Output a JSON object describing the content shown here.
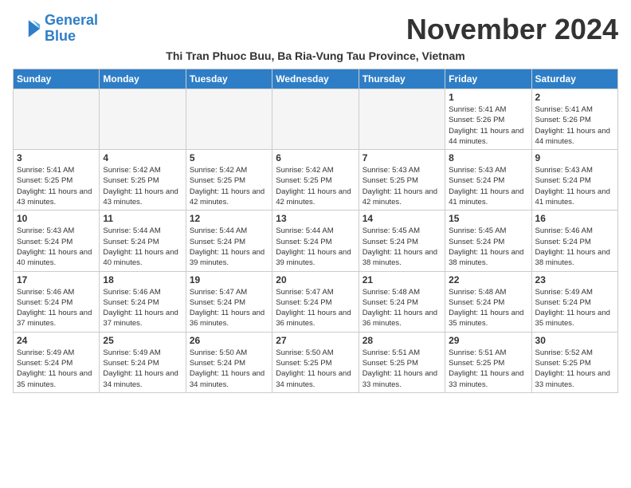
{
  "logo": {
    "line1": "General",
    "line2": "Blue"
  },
  "title": "November 2024",
  "subtitle": "Thi Tran Phuoc Buu, Ba Ria-Vung Tau Province, Vietnam",
  "days_of_week": [
    "Sunday",
    "Monday",
    "Tuesday",
    "Wednesday",
    "Thursday",
    "Friday",
    "Saturday"
  ],
  "weeks": [
    [
      {
        "day": "",
        "info": ""
      },
      {
        "day": "",
        "info": ""
      },
      {
        "day": "",
        "info": ""
      },
      {
        "day": "",
        "info": ""
      },
      {
        "day": "",
        "info": ""
      },
      {
        "day": "1",
        "info": "Sunrise: 5:41 AM\nSunset: 5:26 PM\nDaylight: 11 hours and 44 minutes."
      },
      {
        "day": "2",
        "info": "Sunrise: 5:41 AM\nSunset: 5:26 PM\nDaylight: 11 hours and 44 minutes."
      }
    ],
    [
      {
        "day": "3",
        "info": "Sunrise: 5:41 AM\nSunset: 5:25 PM\nDaylight: 11 hours and 43 minutes."
      },
      {
        "day": "4",
        "info": "Sunrise: 5:42 AM\nSunset: 5:25 PM\nDaylight: 11 hours and 43 minutes."
      },
      {
        "day": "5",
        "info": "Sunrise: 5:42 AM\nSunset: 5:25 PM\nDaylight: 11 hours and 42 minutes."
      },
      {
        "day": "6",
        "info": "Sunrise: 5:42 AM\nSunset: 5:25 PM\nDaylight: 11 hours and 42 minutes."
      },
      {
        "day": "7",
        "info": "Sunrise: 5:43 AM\nSunset: 5:25 PM\nDaylight: 11 hours and 42 minutes."
      },
      {
        "day": "8",
        "info": "Sunrise: 5:43 AM\nSunset: 5:24 PM\nDaylight: 11 hours and 41 minutes."
      },
      {
        "day": "9",
        "info": "Sunrise: 5:43 AM\nSunset: 5:24 PM\nDaylight: 11 hours and 41 minutes."
      }
    ],
    [
      {
        "day": "10",
        "info": "Sunrise: 5:43 AM\nSunset: 5:24 PM\nDaylight: 11 hours and 40 minutes."
      },
      {
        "day": "11",
        "info": "Sunrise: 5:44 AM\nSunset: 5:24 PM\nDaylight: 11 hours and 40 minutes."
      },
      {
        "day": "12",
        "info": "Sunrise: 5:44 AM\nSunset: 5:24 PM\nDaylight: 11 hours and 39 minutes."
      },
      {
        "day": "13",
        "info": "Sunrise: 5:44 AM\nSunset: 5:24 PM\nDaylight: 11 hours and 39 minutes."
      },
      {
        "day": "14",
        "info": "Sunrise: 5:45 AM\nSunset: 5:24 PM\nDaylight: 11 hours and 38 minutes."
      },
      {
        "day": "15",
        "info": "Sunrise: 5:45 AM\nSunset: 5:24 PM\nDaylight: 11 hours and 38 minutes."
      },
      {
        "day": "16",
        "info": "Sunrise: 5:46 AM\nSunset: 5:24 PM\nDaylight: 11 hours and 38 minutes."
      }
    ],
    [
      {
        "day": "17",
        "info": "Sunrise: 5:46 AM\nSunset: 5:24 PM\nDaylight: 11 hours and 37 minutes."
      },
      {
        "day": "18",
        "info": "Sunrise: 5:46 AM\nSunset: 5:24 PM\nDaylight: 11 hours and 37 minutes."
      },
      {
        "day": "19",
        "info": "Sunrise: 5:47 AM\nSunset: 5:24 PM\nDaylight: 11 hours and 36 minutes."
      },
      {
        "day": "20",
        "info": "Sunrise: 5:47 AM\nSunset: 5:24 PM\nDaylight: 11 hours and 36 minutes."
      },
      {
        "day": "21",
        "info": "Sunrise: 5:48 AM\nSunset: 5:24 PM\nDaylight: 11 hours and 36 minutes."
      },
      {
        "day": "22",
        "info": "Sunrise: 5:48 AM\nSunset: 5:24 PM\nDaylight: 11 hours and 35 minutes."
      },
      {
        "day": "23",
        "info": "Sunrise: 5:49 AM\nSunset: 5:24 PM\nDaylight: 11 hours and 35 minutes."
      }
    ],
    [
      {
        "day": "24",
        "info": "Sunrise: 5:49 AM\nSunset: 5:24 PM\nDaylight: 11 hours and 35 minutes."
      },
      {
        "day": "25",
        "info": "Sunrise: 5:49 AM\nSunset: 5:24 PM\nDaylight: 11 hours and 34 minutes."
      },
      {
        "day": "26",
        "info": "Sunrise: 5:50 AM\nSunset: 5:24 PM\nDaylight: 11 hours and 34 minutes."
      },
      {
        "day": "27",
        "info": "Sunrise: 5:50 AM\nSunset: 5:25 PM\nDaylight: 11 hours and 34 minutes."
      },
      {
        "day": "28",
        "info": "Sunrise: 5:51 AM\nSunset: 5:25 PM\nDaylight: 11 hours and 33 minutes."
      },
      {
        "day": "29",
        "info": "Sunrise: 5:51 AM\nSunset: 5:25 PM\nDaylight: 11 hours and 33 minutes."
      },
      {
        "day": "30",
        "info": "Sunrise: 5:52 AM\nSunset: 5:25 PM\nDaylight: 11 hours and 33 minutes."
      }
    ]
  ]
}
